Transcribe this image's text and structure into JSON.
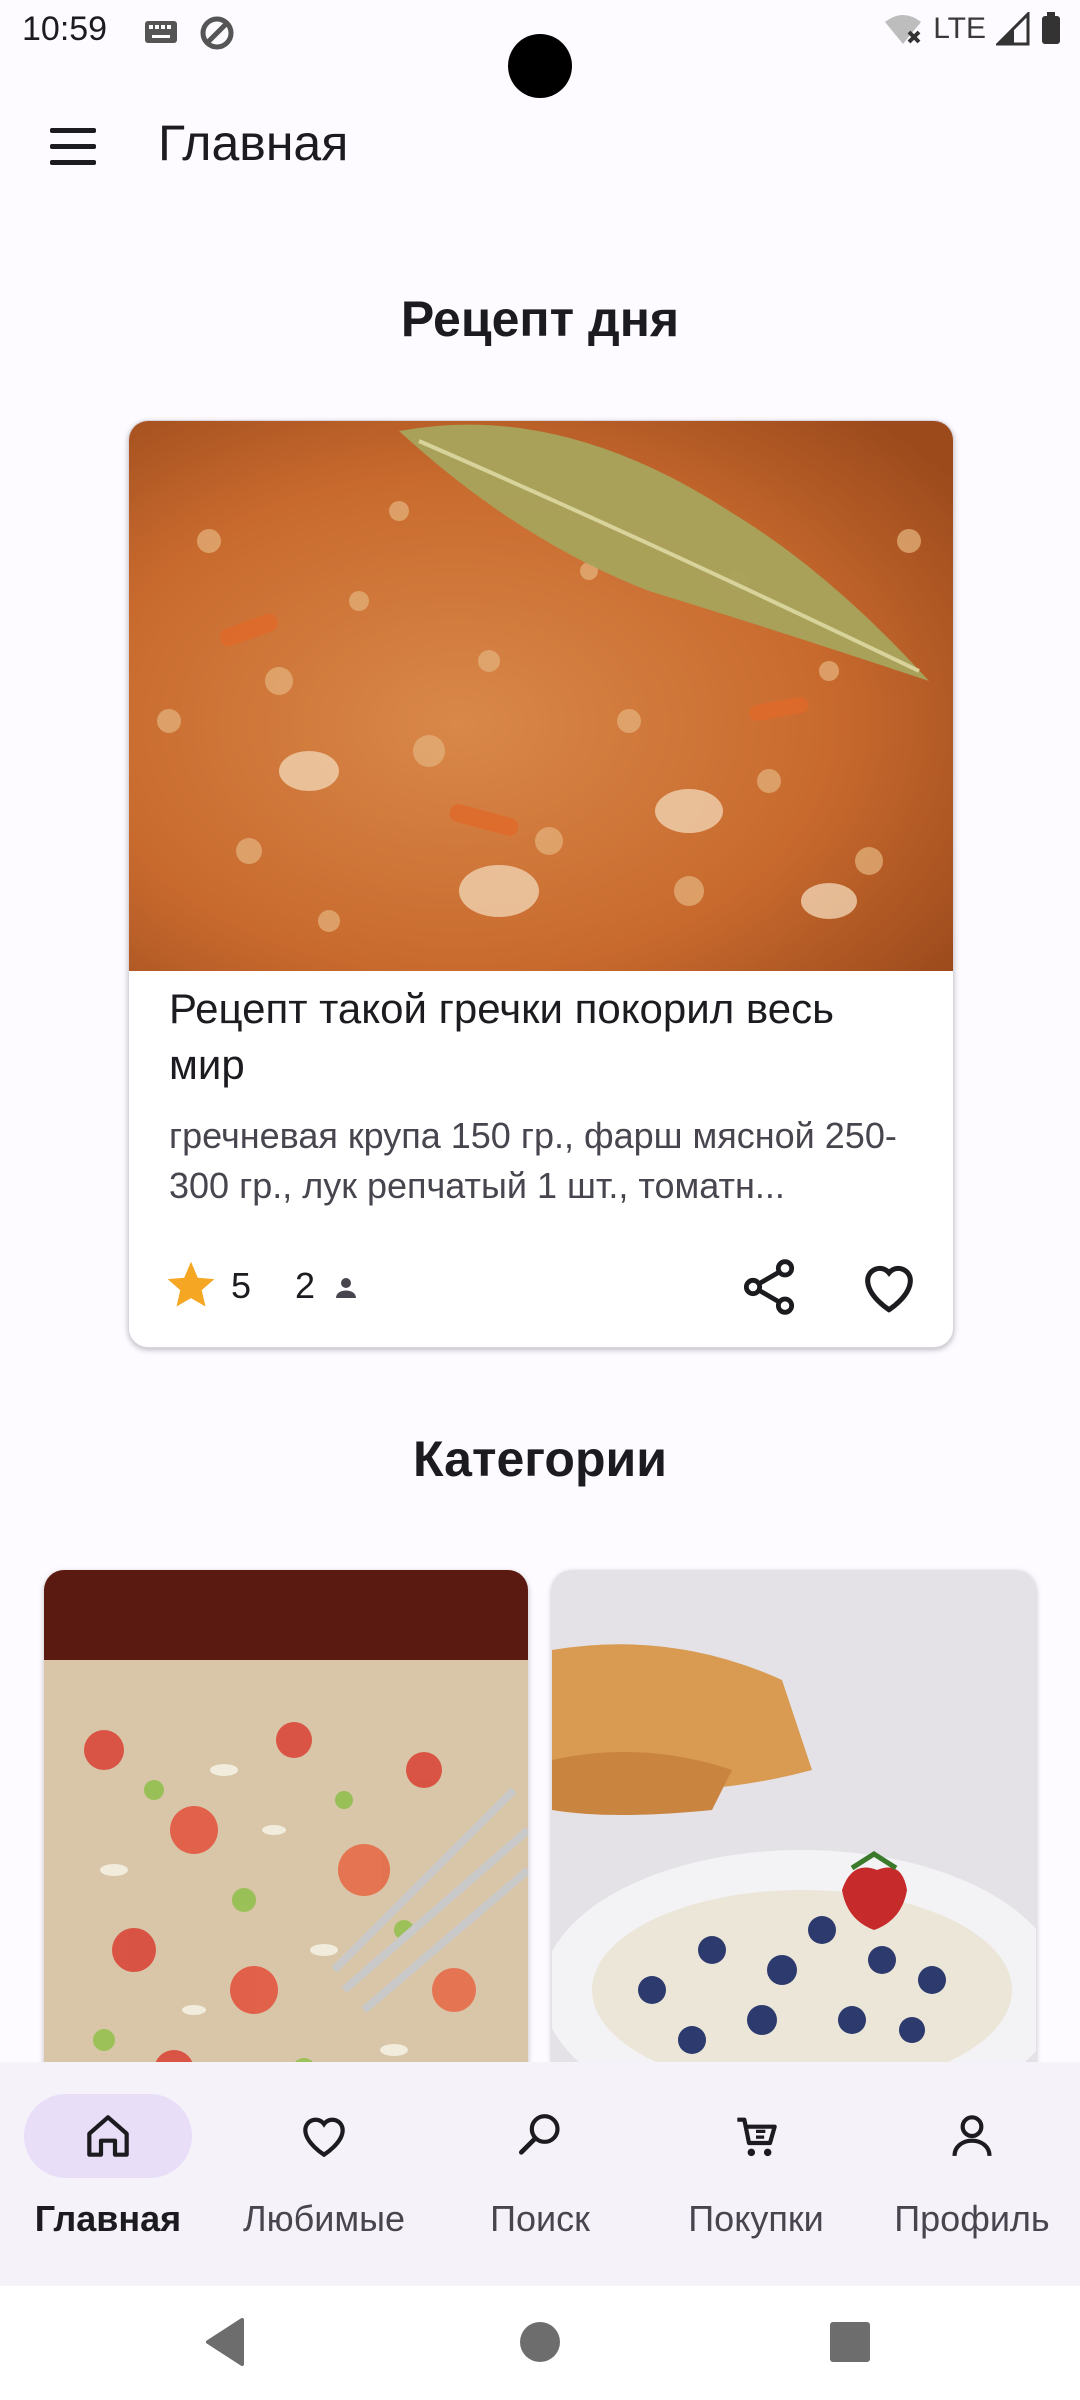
{
  "status_bar": {
    "time": "10:59",
    "network": "LTE"
  },
  "app_bar": {
    "title": "Главная"
  },
  "recipe_of_day": {
    "section_title": "Рецепт  дня",
    "title": "Рецепт такой гречки покорил весь мир",
    "description": "гречневая крупа 150 гр., фарш мясной 250-300 гр., лук репчатый 1 шт., томатн...",
    "rating": "5",
    "servings": "2"
  },
  "categories": {
    "section_title": "Категории"
  },
  "bottom_nav": {
    "items": [
      {
        "label": "Главная",
        "icon": "home-icon",
        "active": true
      },
      {
        "label": "Любимые",
        "icon": "heart-icon",
        "active": false
      },
      {
        "label": "Поиск",
        "icon": "search-icon",
        "active": false
      },
      {
        "label": "Покупки",
        "icon": "cart-icon",
        "active": false
      },
      {
        "label": "Профиль",
        "icon": "profile-icon",
        "active": false
      }
    ]
  },
  "colors": {
    "accent_pill": "#e8def8",
    "star": "#f5a623",
    "background": "#fdfbff",
    "nav_background": "#f6f2fa"
  }
}
